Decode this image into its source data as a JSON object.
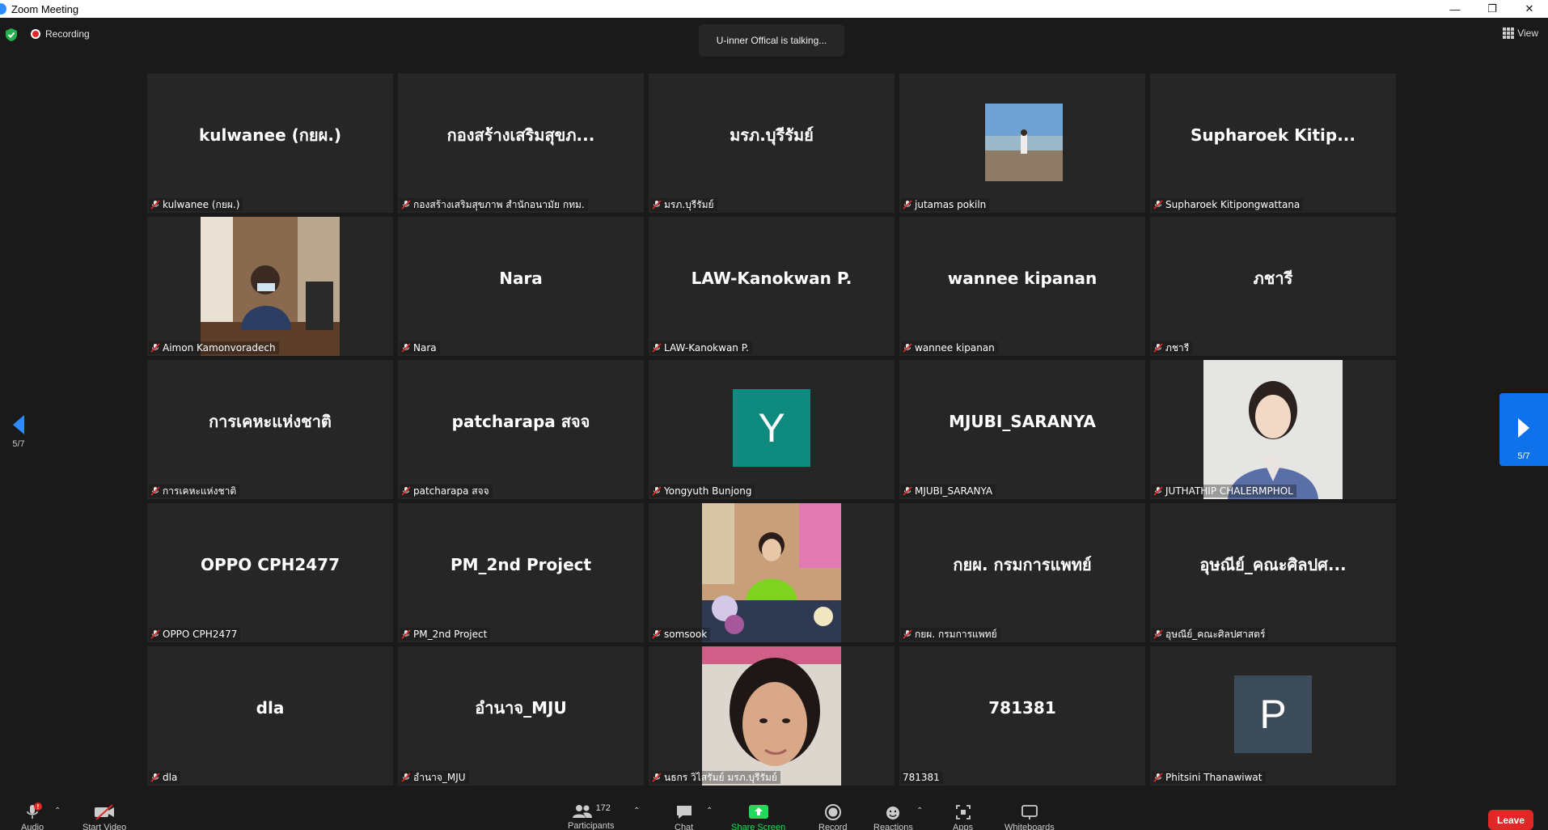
{
  "window": {
    "title": "Zoom Meeting",
    "controls": [
      "—",
      "❐",
      "✕"
    ]
  },
  "status": {
    "recording_label": "Recording",
    "talking_text": "U-inner Offical is talking...",
    "view_label": "View"
  },
  "navigation": {
    "left_page": "5/7",
    "right_page": "5/7"
  },
  "participants": [
    {
      "tile_name": "kulwanee  (กยผ.)",
      "label": "kulwanee (กยผ.)"
    },
    {
      "tile_name": "กองสร้างเสริมสุขภ...",
      "label": "กองสร้างเสริมสุขภาพ สำนักอนามัย กทม."
    },
    {
      "tile_name": "มรภ.บุรีรัมย์",
      "label": "มรภ.บุรีรัมย์"
    },
    {
      "tile_name": "",
      "label": "jutamas pokiln",
      "video": "landscape-photo"
    },
    {
      "tile_name": "Supharoek  Kitip...",
      "label": "Supharoek Kitipongwattana"
    },
    {
      "tile_name": "",
      "label": "Aimon Kamonvoradech",
      "video": "office-photo"
    },
    {
      "tile_name": "Nara",
      "label": "Nara"
    },
    {
      "tile_name": "LAW-Kanokwan P.",
      "label": "LAW-Kanokwan P."
    },
    {
      "tile_name": "wannee kipanan",
      "label": "wannee kipanan"
    },
    {
      "tile_name": "ภชารี",
      "label": "ภชารี"
    },
    {
      "tile_name": "การเคหะแห่งชาติ",
      "label": "การเคหะแห่งชาติ"
    },
    {
      "tile_name": "patcharapa สจจ",
      "label": "patcharapa สจจ"
    },
    {
      "tile_name": "",
      "label": "Yongyuth Bunjong",
      "avatar": "Y",
      "avatar_color": "#0f8a7e"
    },
    {
      "tile_name": "MJUBI_SARANYA",
      "label": "MJUBI_SARANYA"
    },
    {
      "tile_name": "",
      "label": "JUTHATHIP CHALERMPHOL",
      "video": "portrait-photo"
    },
    {
      "tile_name": "OPPO CPH2477",
      "label": "OPPO CPH2477"
    },
    {
      "tile_name": "PM_2nd Project",
      "label": "PM_2nd Project"
    },
    {
      "tile_name": "",
      "label": "somsook",
      "video": "desk-photo"
    },
    {
      "tile_name": "กยผ. กรมการแพทย์",
      "label": "กยผ. กรมการแพทย์"
    },
    {
      "tile_name": "อุษณีย์_คณะศิลปศ...",
      "label": "อุษณีย์_คณะศิลปศาสตร์"
    },
    {
      "tile_name": "dla",
      "label": "dla"
    },
    {
      "tile_name": "อำนาจ_MJU",
      "label": "อำนาจ_MJU"
    },
    {
      "tile_name": "",
      "label": "นธกร วิไสรัมย์ มรภ.บุรีรัมย์",
      "video": "face-photo"
    },
    {
      "tile_name": "781381",
      "label": "781381",
      "unmuted": true
    },
    {
      "tile_name": "",
      "label": "Phitsini Thanawiwat",
      "avatar": "P",
      "avatar_color": "#3c4b5a"
    }
  ],
  "toolbar": {
    "audio_label": "Audio",
    "audio_badge": "!",
    "video_label": "Start Video",
    "participants_label": "Participants",
    "participants_count": "172",
    "chat_label": "Chat",
    "share_label": "Share Screen",
    "record_label": "Record",
    "reactions_label": "Reactions",
    "apps_label": "Apps",
    "whiteboards_label": "Whiteboards",
    "leave_label": "Leave"
  },
  "colors": {
    "accent": "#0e72ed",
    "leave": "#e02828",
    "share": "#23d959",
    "tile_bg": "#262626",
    "bg": "#1a1a1a"
  }
}
